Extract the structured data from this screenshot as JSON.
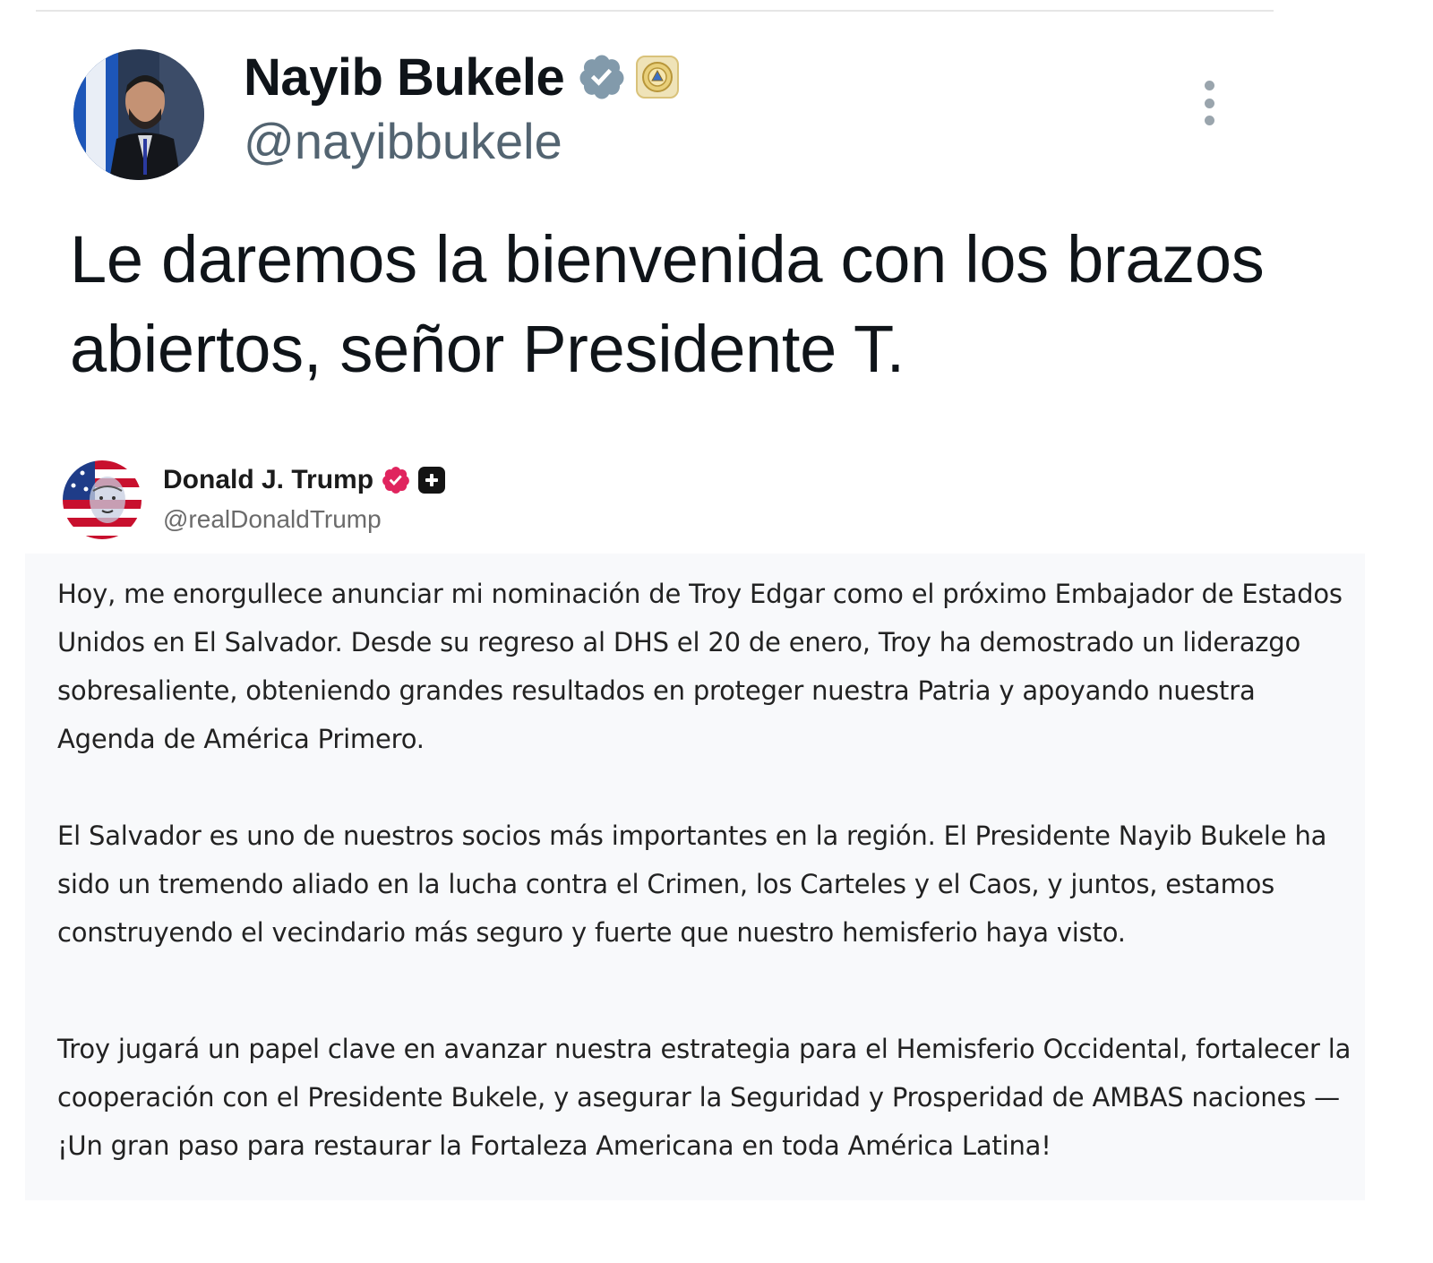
{
  "main_post": {
    "author_name": "Nayib Bukele",
    "author_handle": "@nayibbukele",
    "avatar": "avatar-photo",
    "verified_icon": "verified-badge-icon",
    "affiliation_icon": "el-salvador-seal-icon",
    "more_icon": "more-vertical-icon",
    "text": "Le daremos la bienvenida con los brazos abiertos, señor Presidente T."
  },
  "quoted_post": {
    "author_name": "Donald J. Trump",
    "author_handle": "@realDonaldTrump",
    "avatar": "avatar-photo",
    "verified_icon": "verified-badge-icon",
    "plus_icon": "plus-badge-icon",
    "paragraphs": [
      "Hoy, me enorgullece anunciar mi nominación de Troy Edgar como el próximo Embajador de Estados Unidos en El Salvador. Desde su regreso al DHS el 20 de enero, Troy ha demostrado un liderazgo sobresaliente, obteniendo grandes resultados en proteger nuestra Patria y apoyando nuestra Agenda de América Primero.",
      "El Salvador es uno de nuestros socios más importantes en la región. El Presidente Nayib Bukele ha sido un tremendo aliado en la lucha contra el Crimen, los Carteles y el Caos, y juntos, estamos construyendo el vecindario más seguro y fuerte que nuestro hemisferio haya visto.",
      "Troy jugará un papel clave en avanzar nuestra estrategia para el Hemisferio Occidental, fortalecer la cooperación con el Presidente Bukele, y asegurar la Seguridad y Prosperidad de AMBAS naciones — ¡Un gran paso para restaurar la Fortaleza Americana en toda América Latina!"
    ]
  },
  "colors": {
    "text_primary": "#0f1419",
    "text_secondary": "#536471",
    "verified_gray": "#829aab",
    "verified_pink": "#e0245e",
    "quote_background": "#f8f9fb"
  }
}
